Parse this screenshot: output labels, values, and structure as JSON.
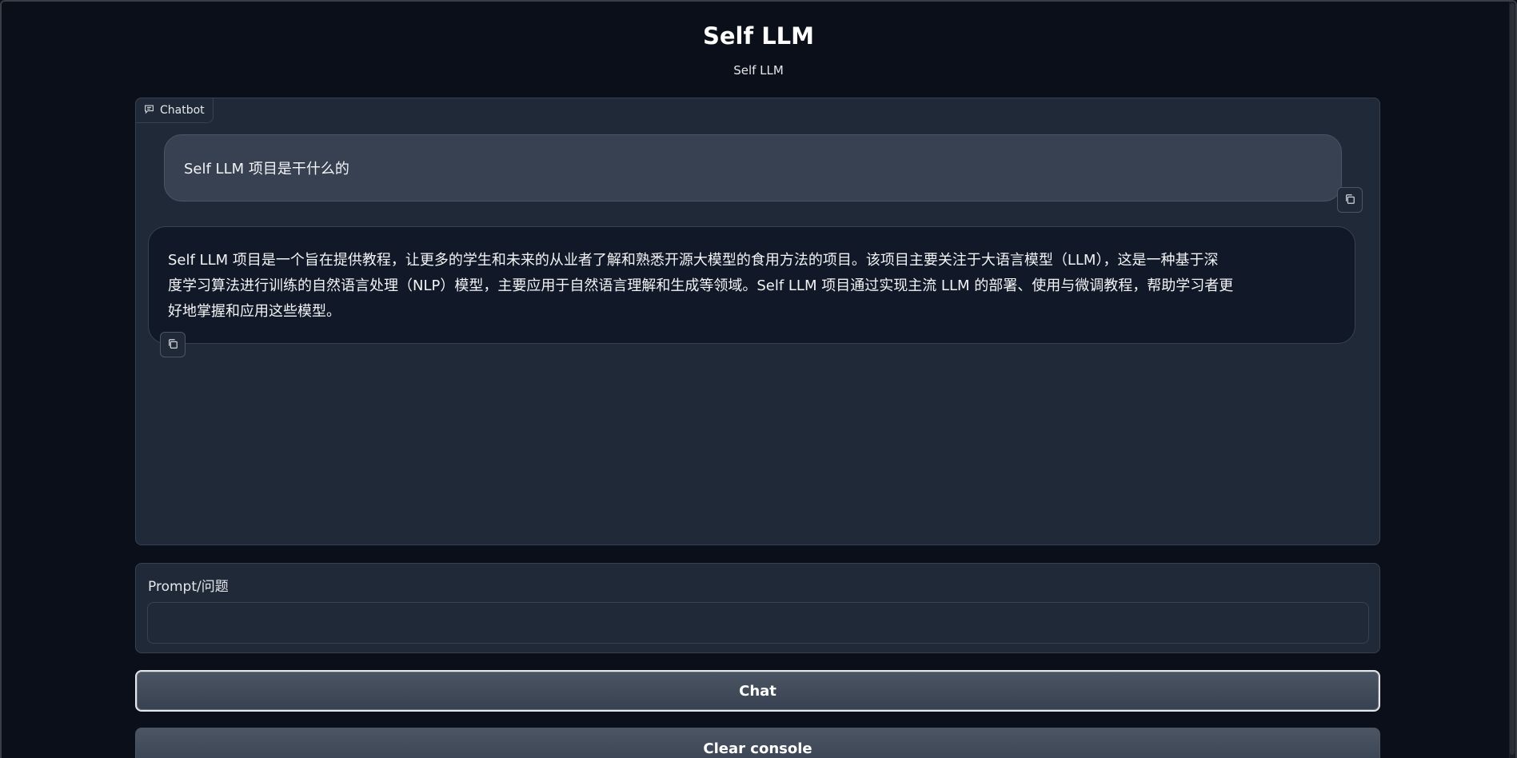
{
  "header": {
    "title": "Self LLM",
    "subtitle": "Self LLM"
  },
  "chatbot": {
    "label": "Chatbot",
    "messages": [
      {
        "role": "user",
        "text": "Self LLM 项目是干什么的"
      },
      {
        "role": "bot",
        "lines": [
          "Self LLM 项目是一个旨在提供教程，让更多的学生和未来的从业者了解和熟悉开源大模型的食用方法的项目。该项目主要关注于大语言模型（LLM），这是一种基于深",
          "度学习算法进行训练的自然语言处理（NLP）模型，主要应用于自然语言理解和生成等领域。Self LLM 项目通过实现主流 LLM 的部署、使用与微调教程，帮助学习者更",
          "好地掌握和应用这些模型。"
        ]
      }
    ]
  },
  "prompt": {
    "label": "Prompt/问题",
    "value": "",
    "placeholder": ""
  },
  "buttons": {
    "chat": "Chat",
    "clear": "Clear console"
  },
  "icons": {
    "chatbot_label_icon": "chat-bubble-icon",
    "copy_icon": "copy-icon"
  },
  "colors": {
    "background": "#0b0f19",
    "panel": "#1f2937",
    "user_bubble": "#374151",
    "bot_bubble": "#111827",
    "border": "#374151"
  }
}
